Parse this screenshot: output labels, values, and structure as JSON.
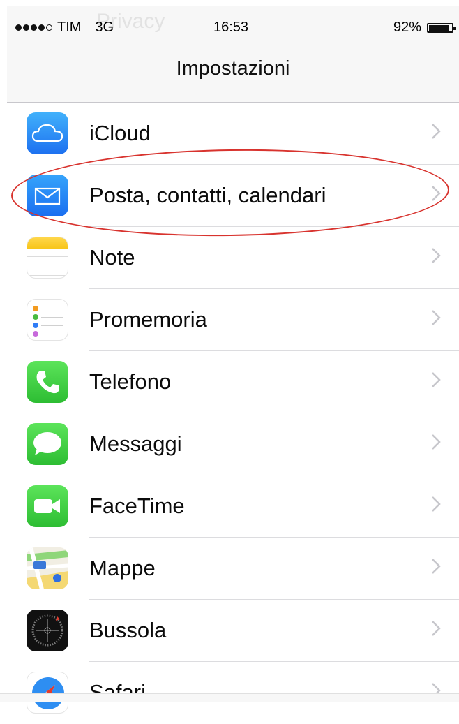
{
  "status_bar": {
    "carrier": "TIM",
    "network": "3G",
    "time": "16:53",
    "battery": "92%",
    "battery_level": 0.92,
    "signal_bars": 4,
    "ghost_text": "Privacy"
  },
  "nav": {
    "title": "Impostazioni"
  },
  "settings": [
    {
      "label": "iCloud",
      "icon": "icloud-icon"
    },
    {
      "label": "Posta, contatti, calendari",
      "icon": "mail-icon"
    },
    {
      "label": "Note",
      "icon": "notes-icon"
    },
    {
      "label": "Promemoria",
      "icon": "reminders-icon"
    },
    {
      "label": "Telefono",
      "icon": "phone-icon"
    },
    {
      "label": "Messaggi",
      "icon": "messages-icon"
    },
    {
      "label": "FaceTime",
      "icon": "facetime-icon"
    },
    {
      "label": "Mappe",
      "icon": "maps-icon"
    },
    {
      "label": "Bussola",
      "icon": "compass-icon"
    },
    {
      "label": "Safari",
      "icon": "safari-icon"
    }
  ],
  "highlight": {
    "color": "#d8332e",
    "target": "Posta, contatti, calendari"
  },
  "colors": {
    "chevron": "#c7c7cc",
    "separator": "#dcdcdf",
    "bar_bg": "#f7f7f7"
  }
}
